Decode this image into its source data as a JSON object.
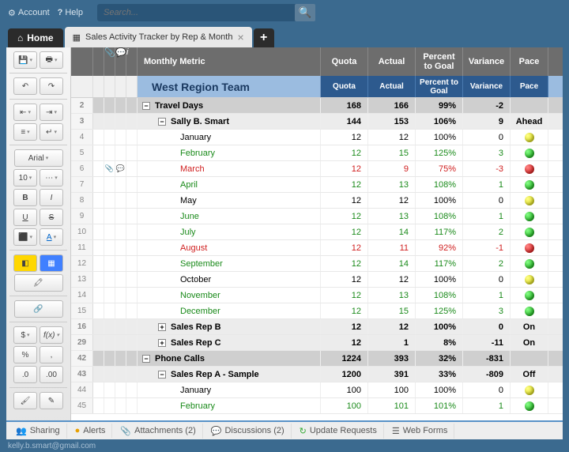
{
  "topbar": {
    "account": "Account",
    "help": "Help",
    "search_placeholder": "Search..."
  },
  "tabs": {
    "home": "Home",
    "sheet": "Sales Activity Tracker by Rep & Month"
  },
  "toolbar": {
    "font": "Arial",
    "size": "10",
    "bold": "B",
    "italic": "I",
    "underline": "U",
    "strike": "S",
    "currency": "$",
    "fx": "f(x)",
    "pct": "%",
    "comma": ",",
    "dec1": ".0",
    "dec2": ".00",
    "link": "🔗"
  },
  "columns": {
    "name": "Monthly Metric",
    "quota": "Quota",
    "actual": "Actual",
    "pct": "Percent to Goal",
    "var": "Variance",
    "pace": "Pace"
  },
  "team_header": "West Region Team",
  "header2": {
    "quota": "Quota",
    "actual": "Actual",
    "pct": "Percent to Goal",
    "var": "Variance",
    "pace": "Pace"
  },
  "rows": [
    {
      "rn": "2",
      "type": "sec",
      "name": "Travel Days",
      "quota": "168",
      "actual": "166",
      "pct": "99%",
      "var": "-2",
      "pace": ""
    },
    {
      "rn": "3",
      "type": "sub",
      "name": "Sally B. Smart",
      "quota": "144",
      "actual": "153",
      "pct": "106%",
      "var": "9",
      "pace": "Ahead"
    },
    {
      "rn": "4",
      "type": "m",
      "name": "January",
      "quota": "12",
      "actual": "12",
      "pct": "100%",
      "var": "0",
      "dot": "y"
    },
    {
      "rn": "5",
      "type": "m",
      "cls": "green",
      "name": "February",
      "quota": "12",
      "actual": "15",
      "pct": "125%",
      "var": "3",
      "dot": "g"
    },
    {
      "rn": "6",
      "type": "m",
      "cls": "red",
      "icons": true,
      "name": "March",
      "quota": "12",
      "actual": "9",
      "pct": "75%",
      "var": "-3",
      "dot": "r"
    },
    {
      "rn": "7",
      "type": "m",
      "cls": "green",
      "name": "April",
      "quota": "12",
      "actual": "13",
      "pct": "108%",
      "var": "1",
      "dot": "g"
    },
    {
      "rn": "8",
      "type": "m",
      "name": "May",
      "quota": "12",
      "actual": "12",
      "pct": "100%",
      "var": "0",
      "dot": "y"
    },
    {
      "rn": "9",
      "type": "m",
      "cls": "green",
      "name": "June",
      "quota": "12",
      "actual": "13",
      "pct": "108%",
      "var": "1",
      "dot": "g"
    },
    {
      "rn": "10",
      "type": "m",
      "cls": "green",
      "name": "July",
      "quota": "12",
      "actual": "14",
      "pct": "117%",
      "var": "2",
      "dot": "g"
    },
    {
      "rn": "11",
      "type": "m",
      "cls": "red",
      "name": "August",
      "quota": "12",
      "actual": "11",
      "pct": "92%",
      "var": "-1",
      "dot": "r"
    },
    {
      "rn": "12",
      "type": "m",
      "cls": "green",
      "name": "September",
      "quota": "12",
      "actual": "14",
      "pct": "117%",
      "var": "2",
      "dot": "g"
    },
    {
      "rn": "13",
      "type": "m",
      "name": "October",
      "quota": "12",
      "actual": "12",
      "pct": "100%",
      "var": "0",
      "dot": "y"
    },
    {
      "rn": "14",
      "type": "m",
      "cls": "green",
      "name": "November",
      "quota": "12",
      "actual": "13",
      "pct": "108%",
      "var": "1",
      "dot": "g"
    },
    {
      "rn": "15",
      "type": "m",
      "cls": "green",
      "name": "December",
      "quota": "12",
      "actual": "15",
      "pct": "125%",
      "var": "3",
      "dot": "g"
    },
    {
      "rn": "16",
      "type": "sub",
      "exp": "+",
      "name": "Sales Rep B",
      "quota": "12",
      "actual": "12",
      "pct": "100%",
      "var": "0",
      "pace": "On"
    },
    {
      "rn": "29",
      "type": "sub",
      "exp": "+",
      "name": "Sales Rep C",
      "quota": "12",
      "actual": "1",
      "pct": "8%",
      "var": "-11",
      "pace": "On"
    },
    {
      "rn": "42",
      "type": "sec",
      "name": "Phone Calls",
      "quota": "1224",
      "actual": "393",
      "pct": "32%",
      "var": "-831",
      "pace": ""
    },
    {
      "rn": "43",
      "type": "sub",
      "name": "Sales Rep A - Sample",
      "quota": "1200",
      "actual": "391",
      "pct": "33%",
      "var": "-809",
      "pace": "Off"
    },
    {
      "rn": "44",
      "type": "m",
      "name": "January",
      "quota": "100",
      "actual": "100",
      "pct": "100%",
      "var": "0",
      "dot": "y"
    },
    {
      "rn": "45",
      "type": "m",
      "cls": "green",
      "name": "February",
      "quota": "100",
      "actual": "101",
      "pct": "101%",
      "var": "1",
      "dot": "g"
    }
  ],
  "bottom": {
    "sharing": "Sharing",
    "alerts": "Alerts",
    "attach": "Attachments  (2)",
    "disc": "Discussions  (2)",
    "upd": "Update Requests",
    "web": "Web Forms"
  },
  "footer": "kelly.b.smart@gmail.com"
}
